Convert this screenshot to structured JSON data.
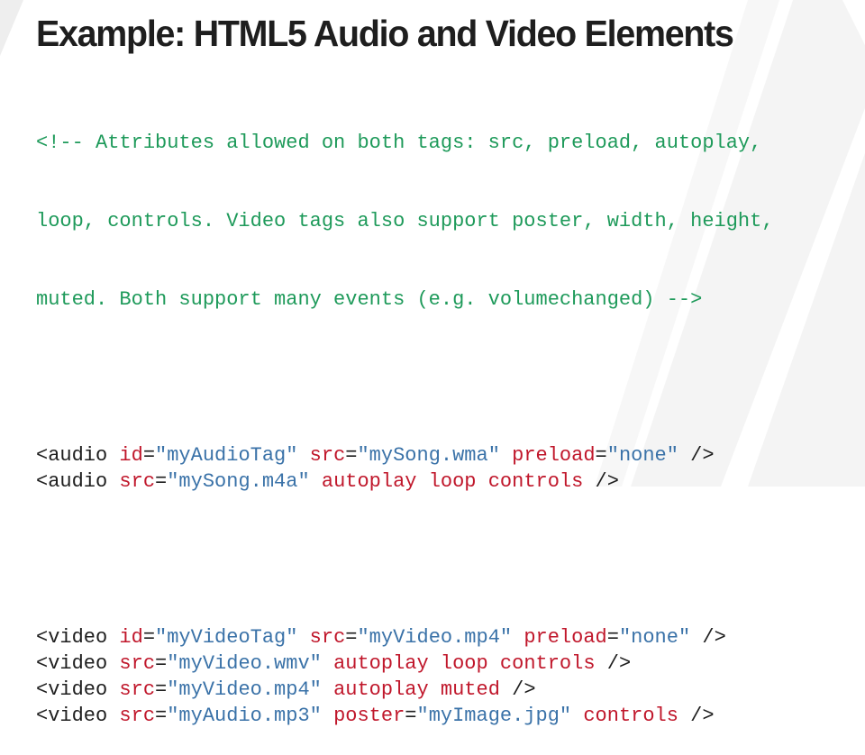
{
  "title": "Example: HTML5 Audio and Video Elements",
  "comment_lines": [
    "<!-- Attributes allowed on both tags: src, preload, autoplay,",
    "loop, controls. Video tags also support poster, width, height,",
    "muted. Both support many events (e.g. volumechanged) -->"
  ],
  "audio_lines": [
    {
      "tag": "<audio",
      "parts": [
        {
          "type": "attr",
          "text": "id"
        },
        {
          "type": "punct",
          "text": "="
        },
        {
          "type": "val",
          "text": "\"myAudioTag\""
        },
        {
          "type": "attr",
          "text": "src"
        },
        {
          "type": "punct",
          "text": "="
        },
        {
          "type": "val",
          "text": "\"mySong.wma\""
        },
        {
          "type": "attr",
          "text": "preload"
        },
        {
          "type": "punct",
          "text": "="
        },
        {
          "type": "val",
          "text": "\"none\""
        },
        {
          "type": "punct",
          "text": "/>"
        }
      ]
    },
    {
      "tag": "<audio",
      "parts": [
        {
          "type": "attr",
          "text": "src"
        },
        {
          "type": "punct",
          "text": "="
        },
        {
          "type": "val",
          "text": "\"mySong.m4a\""
        },
        {
          "type": "attr",
          "text": "autoplay"
        },
        {
          "type": "attr",
          "text": "loop"
        },
        {
          "type": "attr",
          "text": "controls"
        },
        {
          "type": "punct",
          "text": "/>"
        }
      ]
    }
  ],
  "video_lines": [
    {
      "tag": "<video",
      "parts": [
        {
          "type": "attr",
          "text": "id"
        },
        {
          "type": "punct",
          "text": "="
        },
        {
          "type": "val",
          "text": "\"myVideoTag\""
        },
        {
          "type": "attr",
          "text": "src"
        },
        {
          "type": "punct",
          "text": "="
        },
        {
          "type": "val",
          "text": "\"myVideo.mp4\""
        },
        {
          "type": "attr",
          "text": "preload"
        },
        {
          "type": "punct",
          "text": "="
        },
        {
          "type": "val",
          "text": "\"none\""
        },
        {
          "type": "punct",
          "text": "/>"
        }
      ]
    },
    {
      "tag": "<video",
      "parts": [
        {
          "type": "attr",
          "text": "src"
        },
        {
          "type": "punct",
          "text": "="
        },
        {
          "type": "val",
          "text": "\"myVideo.wmv\""
        },
        {
          "type": "attr",
          "text": "autoplay"
        },
        {
          "type": "attr",
          "text": "loop"
        },
        {
          "type": "attr",
          "text": "controls"
        },
        {
          "type": "punct",
          "text": "/>"
        }
      ]
    },
    {
      "tag": "<video",
      "parts": [
        {
          "type": "attr",
          "text": "src"
        },
        {
          "type": "punct",
          "text": "="
        },
        {
          "type": "val",
          "text": "\"myVideo.mp4\""
        },
        {
          "type": "attr",
          "text": "autoplay"
        },
        {
          "type": "attr",
          "text": "muted"
        },
        {
          "type": "punct",
          "text": "/>"
        }
      ]
    },
    {
      "tag": "<video",
      "parts": [
        {
          "type": "attr",
          "text": "src"
        },
        {
          "type": "punct",
          "text": "="
        },
        {
          "type": "val",
          "text": "\"myAudio.mp3\""
        },
        {
          "type": "attr",
          "text": "poster"
        },
        {
          "type": "punct",
          "text": "="
        },
        {
          "type": "val",
          "text": "\"myImage.jpg\""
        },
        {
          "type": "attr",
          "text": "controls"
        },
        {
          "type": "punct",
          "text": "/>"
        }
      ]
    }
  ],
  "colors": {
    "comment": "#1e9a5a",
    "attribute": "#c0172b",
    "value": "#3a72a8",
    "text": "#1e1e1e"
  }
}
